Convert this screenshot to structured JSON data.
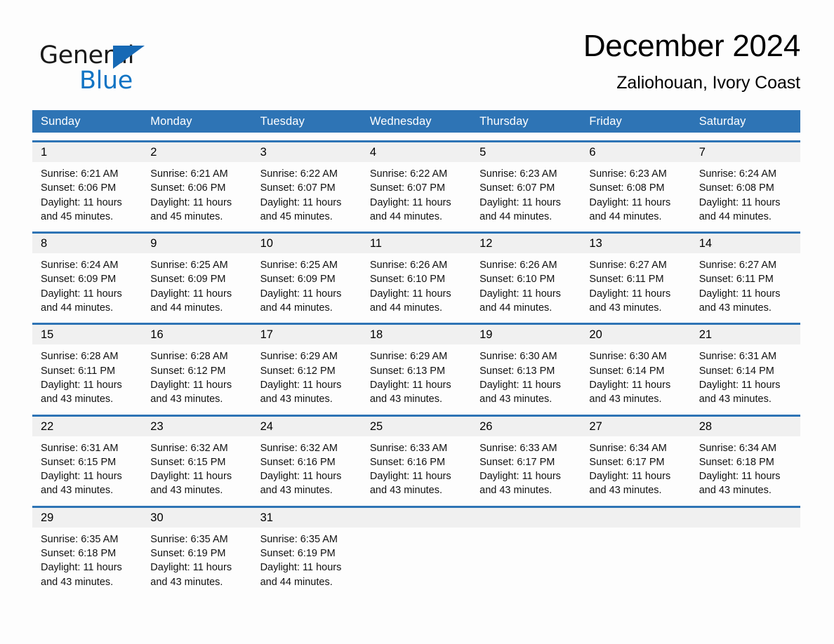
{
  "brand": {
    "name_part1": "General",
    "name_part2": "Blue",
    "logo_icon": "triangle-flag-icon",
    "accent_color": "#1174c4"
  },
  "header": {
    "month_title": "December 2024",
    "location": "Zaliohouan, Ivory Coast"
  },
  "theme": {
    "header_blue": "#2e74b5",
    "day_band_gray": "#f0f0f0",
    "page_background": "#fdfdfd"
  },
  "weekdays": [
    "Sunday",
    "Monday",
    "Tuesday",
    "Wednesday",
    "Thursday",
    "Friday",
    "Saturday"
  ],
  "weeks": [
    [
      {
        "day": "1",
        "sunrise": "Sunrise: 6:21 AM",
        "sunset": "Sunset: 6:06 PM",
        "daylight": "Daylight: 11 hours and 45 minutes."
      },
      {
        "day": "2",
        "sunrise": "Sunrise: 6:21 AM",
        "sunset": "Sunset: 6:06 PM",
        "daylight": "Daylight: 11 hours and 45 minutes."
      },
      {
        "day": "3",
        "sunrise": "Sunrise: 6:22 AM",
        "sunset": "Sunset: 6:07 PM",
        "daylight": "Daylight: 11 hours and 45 minutes."
      },
      {
        "day": "4",
        "sunrise": "Sunrise: 6:22 AM",
        "sunset": "Sunset: 6:07 PM",
        "daylight": "Daylight: 11 hours and 44 minutes."
      },
      {
        "day": "5",
        "sunrise": "Sunrise: 6:23 AM",
        "sunset": "Sunset: 6:07 PM",
        "daylight": "Daylight: 11 hours and 44 minutes."
      },
      {
        "day": "6",
        "sunrise": "Sunrise: 6:23 AM",
        "sunset": "Sunset: 6:08 PM",
        "daylight": "Daylight: 11 hours and 44 minutes."
      },
      {
        "day": "7",
        "sunrise": "Sunrise: 6:24 AM",
        "sunset": "Sunset: 6:08 PM",
        "daylight": "Daylight: 11 hours and 44 minutes."
      }
    ],
    [
      {
        "day": "8",
        "sunrise": "Sunrise: 6:24 AM",
        "sunset": "Sunset: 6:09 PM",
        "daylight": "Daylight: 11 hours and 44 minutes."
      },
      {
        "day": "9",
        "sunrise": "Sunrise: 6:25 AM",
        "sunset": "Sunset: 6:09 PM",
        "daylight": "Daylight: 11 hours and 44 minutes."
      },
      {
        "day": "10",
        "sunrise": "Sunrise: 6:25 AM",
        "sunset": "Sunset: 6:09 PM",
        "daylight": "Daylight: 11 hours and 44 minutes."
      },
      {
        "day": "11",
        "sunrise": "Sunrise: 6:26 AM",
        "sunset": "Sunset: 6:10 PM",
        "daylight": "Daylight: 11 hours and 44 minutes."
      },
      {
        "day": "12",
        "sunrise": "Sunrise: 6:26 AM",
        "sunset": "Sunset: 6:10 PM",
        "daylight": "Daylight: 11 hours and 44 minutes."
      },
      {
        "day": "13",
        "sunrise": "Sunrise: 6:27 AM",
        "sunset": "Sunset: 6:11 PM",
        "daylight": "Daylight: 11 hours and 43 minutes."
      },
      {
        "day": "14",
        "sunrise": "Sunrise: 6:27 AM",
        "sunset": "Sunset: 6:11 PM",
        "daylight": "Daylight: 11 hours and 43 minutes."
      }
    ],
    [
      {
        "day": "15",
        "sunrise": "Sunrise: 6:28 AM",
        "sunset": "Sunset: 6:11 PM",
        "daylight": "Daylight: 11 hours and 43 minutes."
      },
      {
        "day": "16",
        "sunrise": "Sunrise: 6:28 AM",
        "sunset": "Sunset: 6:12 PM",
        "daylight": "Daylight: 11 hours and 43 minutes."
      },
      {
        "day": "17",
        "sunrise": "Sunrise: 6:29 AM",
        "sunset": "Sunset: 6:12 PM",
        "daylight": "Daylight: 11 hours and 43 minutes."
      },
      {
        "day": "18",
        "sunrise": "Sunrise: 6:29 AM",
        "sunset": "Sunset: 6:13 PM",
        "daylight": "Daylight: 11 hours and 43 minutes."
      },
      {
        "day": "19",
        "sunrise": "Sunrise: 6:30 AM",
        "sunset": "Sunset: 6:13 PM",
        "daylight": "Daylight: 11 hours and 43 minutes."
      },
      {
        "day": "20",
        "sunrise": "Sunrise: 6:30 AM",
        "sunset": "Sunset: 6:14 PM",
        "daylight": "Daylight: 11 hours and 43 minutes."
      },
      {
        "day": "21",
        "sunrise": "Sunrise: 6:31 AM",
        "sunset": "Sunset: 6:14 PM",
        "daylight": "Daylight: 11 hours and 43 minutes."
      }
    ],
    [
      {
        "day": "22",
        "sunrise": "Sunrise: 6:31 AM",
        "sunset": "Sunset: 6:15 PM",
        "daylight": "Daylight: 11 hours and 43 minutes."
      },
      {
        "day": "23",
        "sunrise": "Sunrise: 6:32 AM",
        "sunset": "Sunset: 6:15 PM",
        "daylight": "Daylight: 11 hours and 43 minutes."
      },
      {
        "day": "24",
        "sunrise": "Sunrise: 6:32 AM",
        "sunset": "Sunset: 6:16 PM",
        "daylight": "Daylight: 11 hours and 43 minutes."
      },
      {
        "day": "25",
        "sunrise": "Sunrise: 6:33 AM",
        "sunset": "Sunset: 6:16 PM",
        "daylight": "Daylight: 11 hours and 43 minutes."
      },
      {
        "day": "26",
        "sunrise": "Sunrise: 6:33 AM",
        "sunset": "Sunset: 6:17 PM",
        "daylight": "Daylight: 11 hours and 43 minutes."
      },
      {
        "day": "27",
        "sunrise": "Sunrise: 6:34 AM",
        "sunset": "Sunset: 6:17 PM",
        "daylight": "Daylight: 11 hours and 43 minutes."
      },
      {
        "day": "28",
        "sunrise": "Sunrise: 6:34 AM",
        "sunset": "Sunset: 6:18 PM",
        "daylight": "Daylight: 11 hours and 43 minutes."
      }
    ],
    [
      {
        "day": "29",
        "sunrise": "Sunrise: 6:35 AM",
        "sunset": "Sunset: 6:18 PM",
        "daylight": "Daylight: 11 hours and 43 minutes."
      },
      {
        "day": "30",
        "sunrise": "Sunrise: 6:35 AM",
        "sunset": "Sunset: 6:19 PM",
        "daylight": "Daylight: 11 hours and 43 minutes."
      },
      {
        "day": "31",
        "sunrise": "Sunrise: 6:35 AM",
        "sunset": "Sunset: 6:19 PM",
        "daylight": "Daylight: 11 hours and 44 minutes."
      },
      {
        "day": "",
        "sunrise": "",
        "sunset": "",
        "daylight": ""
      },
      {
        "day": "",
        "sunrise": "",
        "sunset": "",
        "daylight": ""
      },
      {
        "day": "",
        "sunrise": "",
        "sunset": "",
        "daylight": ""
      },
      {
        "day": "",
        "sunrise": "",
        "sunset": "",
        "daylight": ""
      }
    ]
  ]
}
